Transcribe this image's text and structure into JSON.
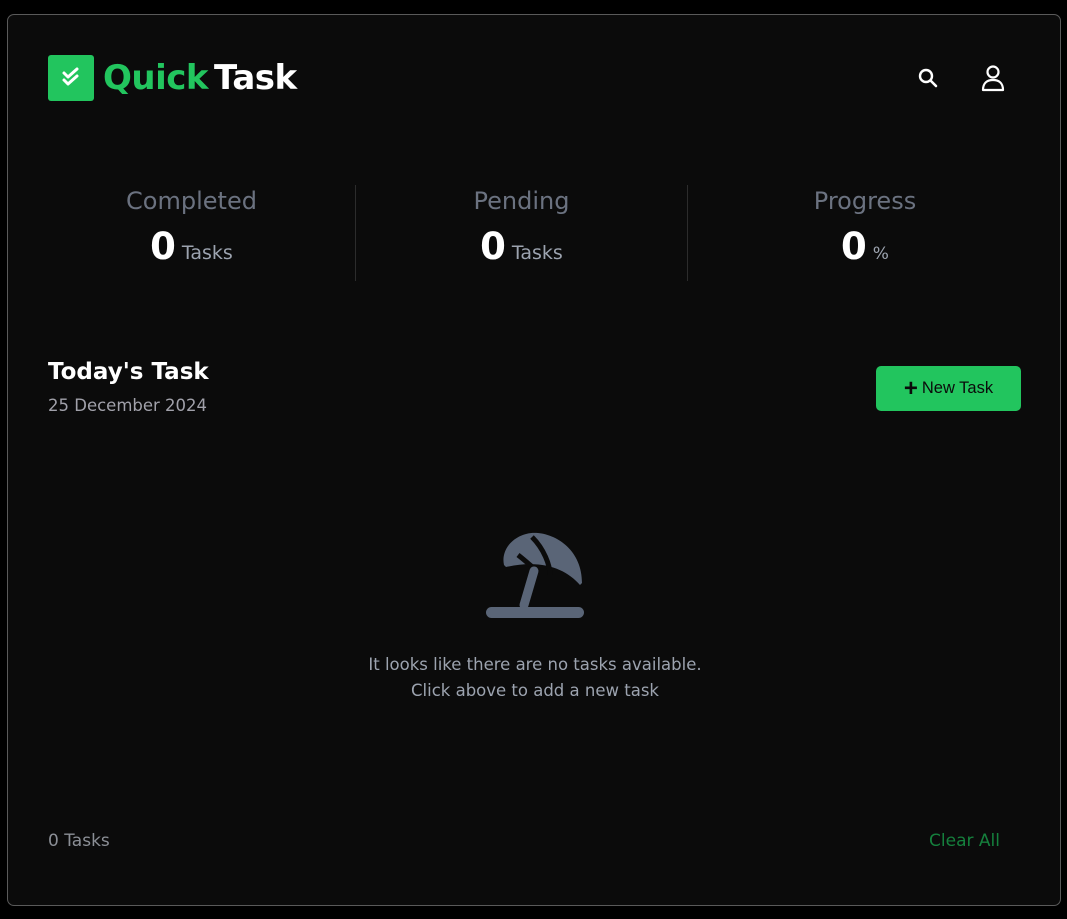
{
  "app": {
    "logo_word1": "Quick",
    "logo_word2": "Task",
    "accent_color": "#22c55e",
    "icons": [
      "check-icon",
      "search-icon",
      "user-icon",
      "plus-icon",
      "beach-umbrella-icon"
    ]
  },
  "stats": {
    "completed": {
      "label": "Completed",
      "value": "0",
      "unit": "Tasks"
    },
    "pending": {
      "label": "Pending",
      "value": "0",
      "unit": "Tasks"
    },
    "progress": {
      "label": "Progress",
      "value": "0",
      "unit": "%"
    }
  },
  "today": {
    "title": "Today's Task",
    "date": "25 December 2024",
    "new_task_label": "New Task"
  },
  "empty_state": {
    "line1": "It looks like there are no tasks available.",
    "line2": "Click above to add a new task"
  },
  "footer": {
    "task_count": "0 Tasks",
    "clear_all_label": "Clear All"
  }
}
